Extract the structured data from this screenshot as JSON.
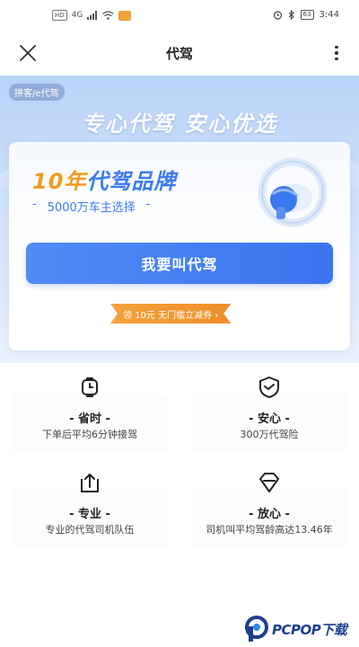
{
  "status_bar": {
    "left_chips": [
      "HD",
      "4G"
    ],
    "time": "3:44",
    "battery": "63"
  },
  "header": {
    "title": "代驾"
  },
  "hero": {
    "source_tag": "拼客/e代驾",
    "slogan": "专心代驾 安心优选",
    "brand_number": "10年",
    "brand_text": "代驾品牌",
    "sub_prefix": "-",
    "sub_text": "5000万车主选择",
    "sub_suffix": "-",
    "call_button": "我要叫代驾",
    "coupon": "领 10元 无门槛立减券 ›"
  },
  "features": [
    {
      "icon": "stopwatch-icon",
      "title": "- 省时 -",
      "desc": "下单后平均6分钟接驾"
    },
    {
      "icon": "shield-check-icon",
      "title": "- 安心 -",
      "desc": "300万代驾险"
    },
    {
      "icon": "badge-upload-icon",
      "title": "- 专业 -",
      "desc": "专业的代驾司机队伍"
    },
    {
      "icon": "diamond-icon",
      "title": "- 放心 -",
      "desc": "司机叫平均驾龄高达13.46年"
    }
  ],
  "watermark": {
    "text": "PCPOP下载"
  },
  "colors": {
    "primary_blue": "#3c7cf0",
    "brand_orange": "#f39a1f",
    "hero_bg": "#cfe0fa"
  }
}
